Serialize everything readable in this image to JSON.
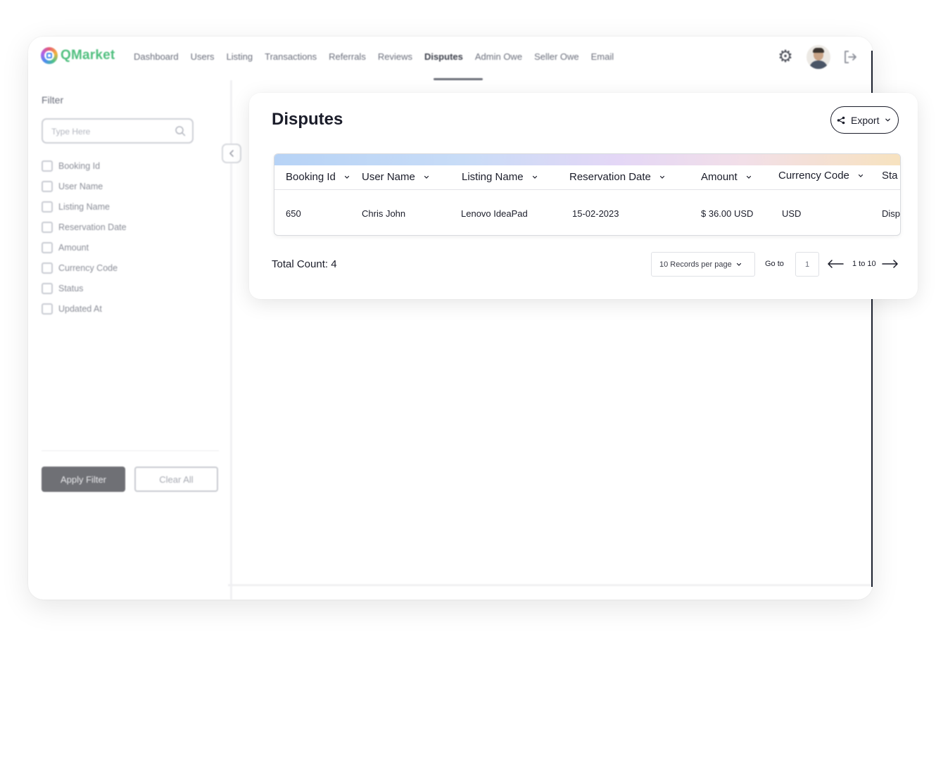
{
  "app": {
    "logo_text": "QMarket",
    "nav": [
      {
        "label": "Dashboard"
      },
      {
        "label": "Users"
      },
      {
        "label": "Listing"
      },
      {
        "label": "Transactions"
      },
      {
        "label": "Referrals"
      },
      {
        "label": "Reviews"
      },
      {
        "label": "Disputes",
        "active": true
      },
      {
        "label": "Admin Owe"
      },
      {
        "label": "Seller Owe"
      },
      {
        "label": "Email"
      }
    ],
    "icons": {
      "settings": "gear-icon",
      "profile": "avatar",
      "logout": "logout-icon"
    }
  },
  "sidebar": {
    "title": "Filter",
    "search_placeholder": "Type Here",
    "filters": [
      {
        "label": "Booking Id"
      },
      {
        "label": "User Name"
      },
      {
        "label": "Listing Name"
      },
      {
        "label": "Reservation Date"
      },
      {
        "label": "Amount"
      },
      {
        "label": "Currency Code"
      },
      {
        "label": "Status"
      },
      {
        "label": "Updated At"
      }
    ],
    "apply_label": "Apply Filter",
    "clear_label": "Clear All"
  },
  "main": {
    "title": "Disputes",
    "export_label": "Export",
    "columns": [
      "Booking Id",
      "User Name",
      "Listing Name",
      "Reservation Date",
      "Amount",
      "Currency Code",
      "Sta"
    ],
    "rows": [
      [
        "650",
        "Chris John",
        "Lenovo IdeaPad",
        "15-02-2023",
        "$ 36.00 USD",
        "USD",
        "Disp"
      ]
    ],
    "total_count": "Total Count: 4",
    "records_per_page": "10 Records per page",
    "goto_label": "Go to",
    "goto_value": "1",
    "range": "1 to 10"
  },
  "colors": {
    "brand_green": "#4fbf7e",
    "title_text": "#1b1d2a",
    "apply_button": "#6f7075"
  }
}
